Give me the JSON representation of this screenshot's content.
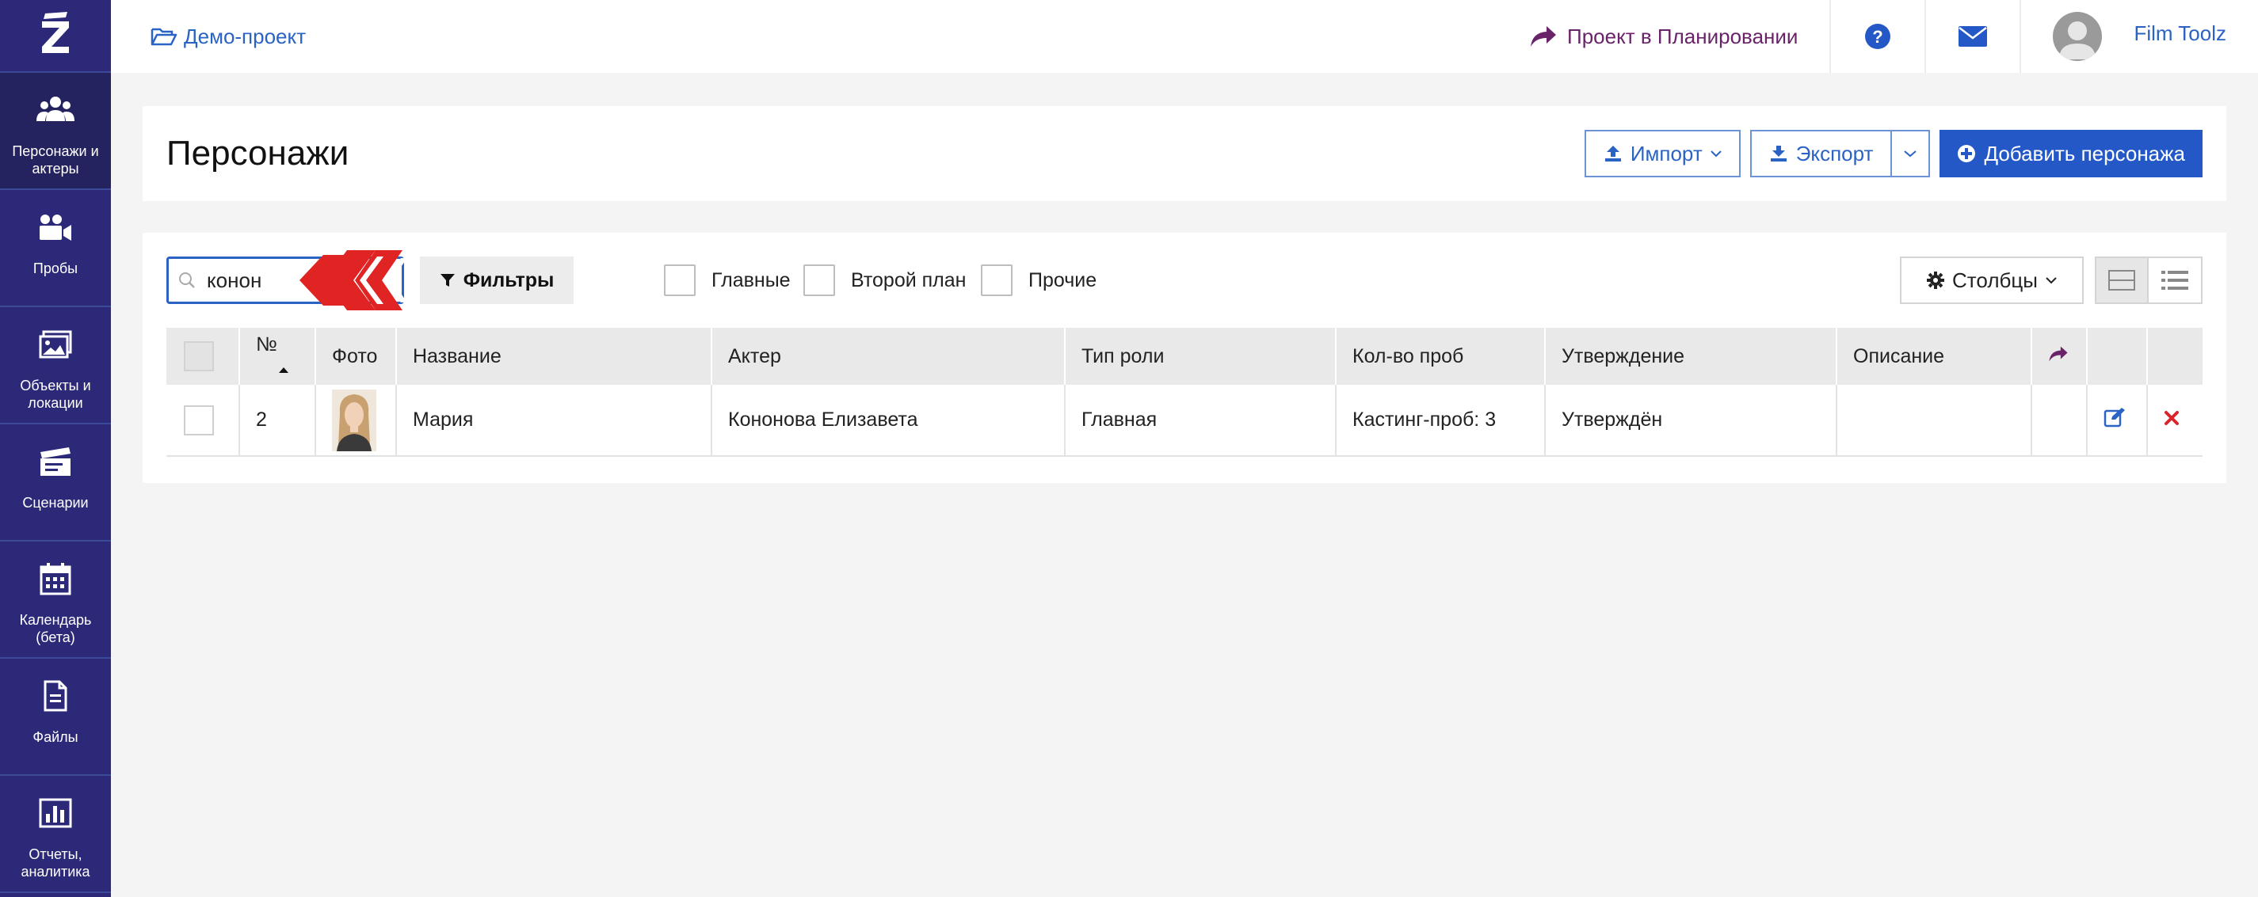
{
  "topbar": {
    "project_link": "Демо-проект",
    "planning_status": "Проект в Планировании",
    "user_name": "Film Toolz"
  },
  "sidebar": {
    "items": [
      {
        "label": "Персонажи и актеры",
        "icon": "people-icon"
      },
      {
        "label": "Пробы",
        "icon": "video-camera-icon"
      },
      {
        "label": "Объекты и локации",
        "icon": "image-icon"
      },
      {
        "label": "Сценарии",
        "icon": "clapperboard-icon"
      },
      {
        "label": "Календарь (бета)",
        "icon": "calendar-icon"
      },
      {
        "label": "Файлы",
        "icon": "file-icon"
      },
      {
        "label": "Отчеты, аналитика",
        "icon": "bar-chart-icon"
      }
    ]
  },
  "page": {
    "title": "Персонажи",
    "import_label": "Импорт",
    "export_label": "Экспорт",
    "add_label": "Добавить персонажа"
  },
  "toolbar": {
    "search_value": "конон",
    "filters_label": "Фильтры",
    "checkbox_main": "Главные",
    "checkbox_secondary": "Второй план",
    "checkbox_other": "Прочие",
    "columns_label": "Столбцы"
  },
  "table": {
    "headers": {
      "number": "№",
      "photo": "Фото",
      "name": "Название",
      "actor": "Актер",
      "role_type": "Тип роли",
      "tests_count": "Кол-во проб",
      "approval": "Утверждение",
      "description": "Описание"
    },
    "rows": [
      {
        "number": "2",
        "name": "Мария",
        "actor": "Кононова Елизавета",
        "role_type": "Главная",
        "tests_count": "Кастинг-проб: 3",
        "approval": "Утверждён",
        "description": ""
      }
    ]
  },
  "colors": {
    "sidebar_bg": "#2c2a78",
    "link_blue": "#2a63c4",
    "primary_button": "#2458c6",
    "planning_purple": "#6a2369",
    "delete_red": "#d9242b",
    "arrow_red": "#e02424"
  }
}
